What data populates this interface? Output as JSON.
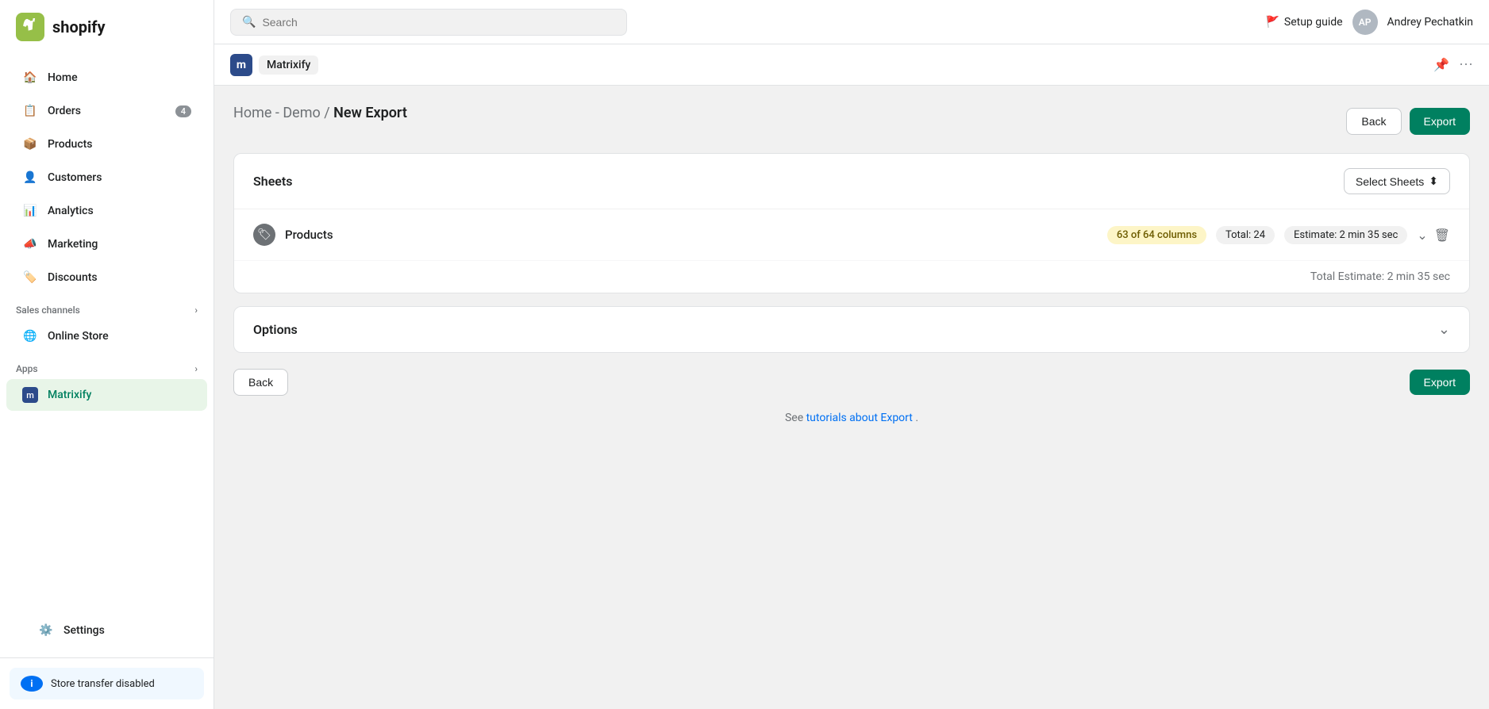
{
  "app": {
    "logo_text": "shopify",
    "logo_initials": "S"
  },
  "topbar": {
    "search_placeholder": "Search",
    "setup_guide_label": "Setup guide",
    "user_initials": "AP",
    "user_name": "Andrey Pechatkin"
  },
  "sidebar": {
    "items": [
      {
        "id": "home",
        "label": "Home",
        "icon": "home"
      },
      {
        "id": "orders",
        "label": "Orders",
        "icon": "orders",
        "badge": "4"
      },
      {
        "id": "products",
        "label": "Products",
        "icon": "products"
      },
      {
        "id": "customers",
        "label": "Customers",
        "icon": "customers"
      },
      {
        "id": "analytics",
        "label": "Analytics",
        "icon": "analytics"
      },
      {
        "id": "marketing",
        "label": "Marketing",
        "icon": "marketing"
      },
      {
        "id": "discounts",
        "label": "Discounts",
        "icon": "discounts"
      }
    ],
    "sales_channels_label": "Sales channels",
    "online_store_label": "Online Store",
    "apps_label": "Apps",
    "matrixify_label": "Matrixify",
    "settings_label": "Settings",
    "store_transfer_label": "Store transfer disabled"
  },
  "app_header": {
    "app_icon_text": "m",
    "app_name": "Matrixify"
  },
  "breadcrumb": {
    "home": "Home",
    "sep1": " - ",
    "demo": "Demo",
    "sep2": " / ",
    "current": "New Export"
  },
  "header_buttons": {
    "back": "Back",
    "export": "Export"
  },
  "sheets_card": {
    "title": "Sheets",
    "select_sheets_label": "Select Sheets",
    "select_sheets_arrow": "⬍"
  },
  "products_row": {
    "icon": "🏷",
    "name": "Products",
    "columns_badge": "63 of 64 columns",
    "total_badge": "Total: 24",
    "estimate_badge": "Estimate: 2 min 35 sec"
  },
  "total_estimate": {
    "label": "Total Estimate: 2 min 35 sec"
  },
  "options_card": {
    "title": "Options"
  },
  "footer": {
    "back_label": "Back",
    "export_label": "Export",
    "tutorials_prefix": "See ",
    "tutorials_link": "tutorials about Export",
    "tutorials_suffix": "."
  }
}
